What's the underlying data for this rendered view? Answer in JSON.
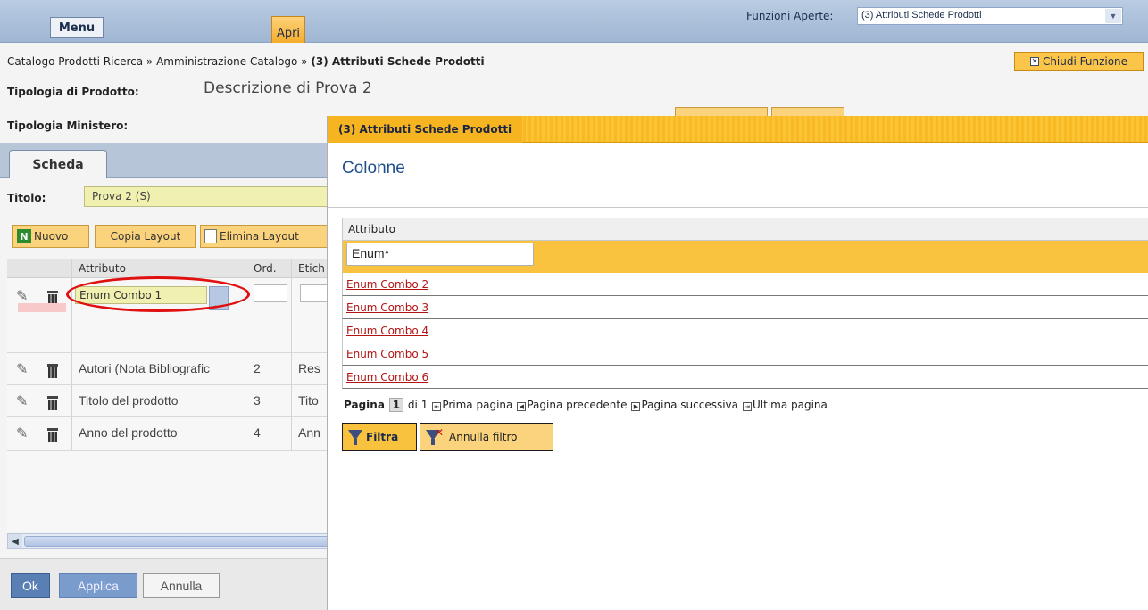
{
  "topbar": {
    "menu_label": "Menu",
    "apri_label": "Apri",
    "funzioni_label": "Funzioni Aperte:",
    "funzioni_selected": "(3) Attributi Schede Prodotti"
  },
  "breadcrumb": {
    "part1": "Catalogo Prodotti Ricerca",
    "sep": "»",
    "part2": "Amministrazione Catalogo",
    "current": "(3) Attributi Schede Prodotti"
  },
  "close_function_label": "Chiudi Funzione",
  "form": {
    "tipologia_prodotto_label": "Tipologia di Prodotto:",
    "tipologia_prodotto_value": "Descrizione di Prova 2",
    "tipologia_ministero_label": "Tipologia Ministero:",
    "tab_label": "Scheda",
    "titolo_label": "Titolo:",
    "titolo_value": "Prova 2 (S)"
  },
  "toolbar": {
    "nuovo": "Nuovo",
    "copia_layout": "Copia Layout",
    "elimina_layout": "Elimina Layout"
  },
  "grid": {
    "headers": {
      "attributo": "Attributo",
      "ord": "Ord.",
      "etichetta": "Etich"
    },
    "edit_row": {
      "attributo": "Enum Combo 1",
      "dots": "..."
    },
    "rows": [
      {
        "attributo": "Autori (Nota Bibliografic",
        "ord": "2",
        "etichetta": "Res"
      },
      {
        "attributo": "Titolo del prodotto",
        "ord": "3",
        "etichetta": "Tito"
      },
      {
        "attributo": "Anno del prodotto",
        "ord": "4",
        "etichetta": "Ann"
      }
    ]
  },
  "bottom": {
    "ok": "Ok",
    "applica": "Applica",
    "annulla": "Annulla"
  },
  "popup": {
    "title": "(3) Attributi Schede Prodotti",
    "heading": "Colonne",
    "column_header": "Attributo",
    "filter_value": "Enum*",
    "items": [
      "Enum Combo 2",
      "Enum Combo 3",
      "Enum Combo 4",
      "Enum Combo 5",
      "Enum Combo 6"
    ],
    "pager": {
      "label": "Pagina",
      "current": "1",
      "of": "di 1",
      "first": "Prima pagina",
      "prev": "Pagina precedente",
      "next": "Pagina successiva",
      "last": "Ultima pagina"
    },
    "filtra": "Filtra",
    "annulla_filtro": "Annulla filtro"
  },
  "colors": {
    "accent": "#f8c23e",
    "header_blue": "#b9cce2",
    "link_red": "#b01515"
  }
}
